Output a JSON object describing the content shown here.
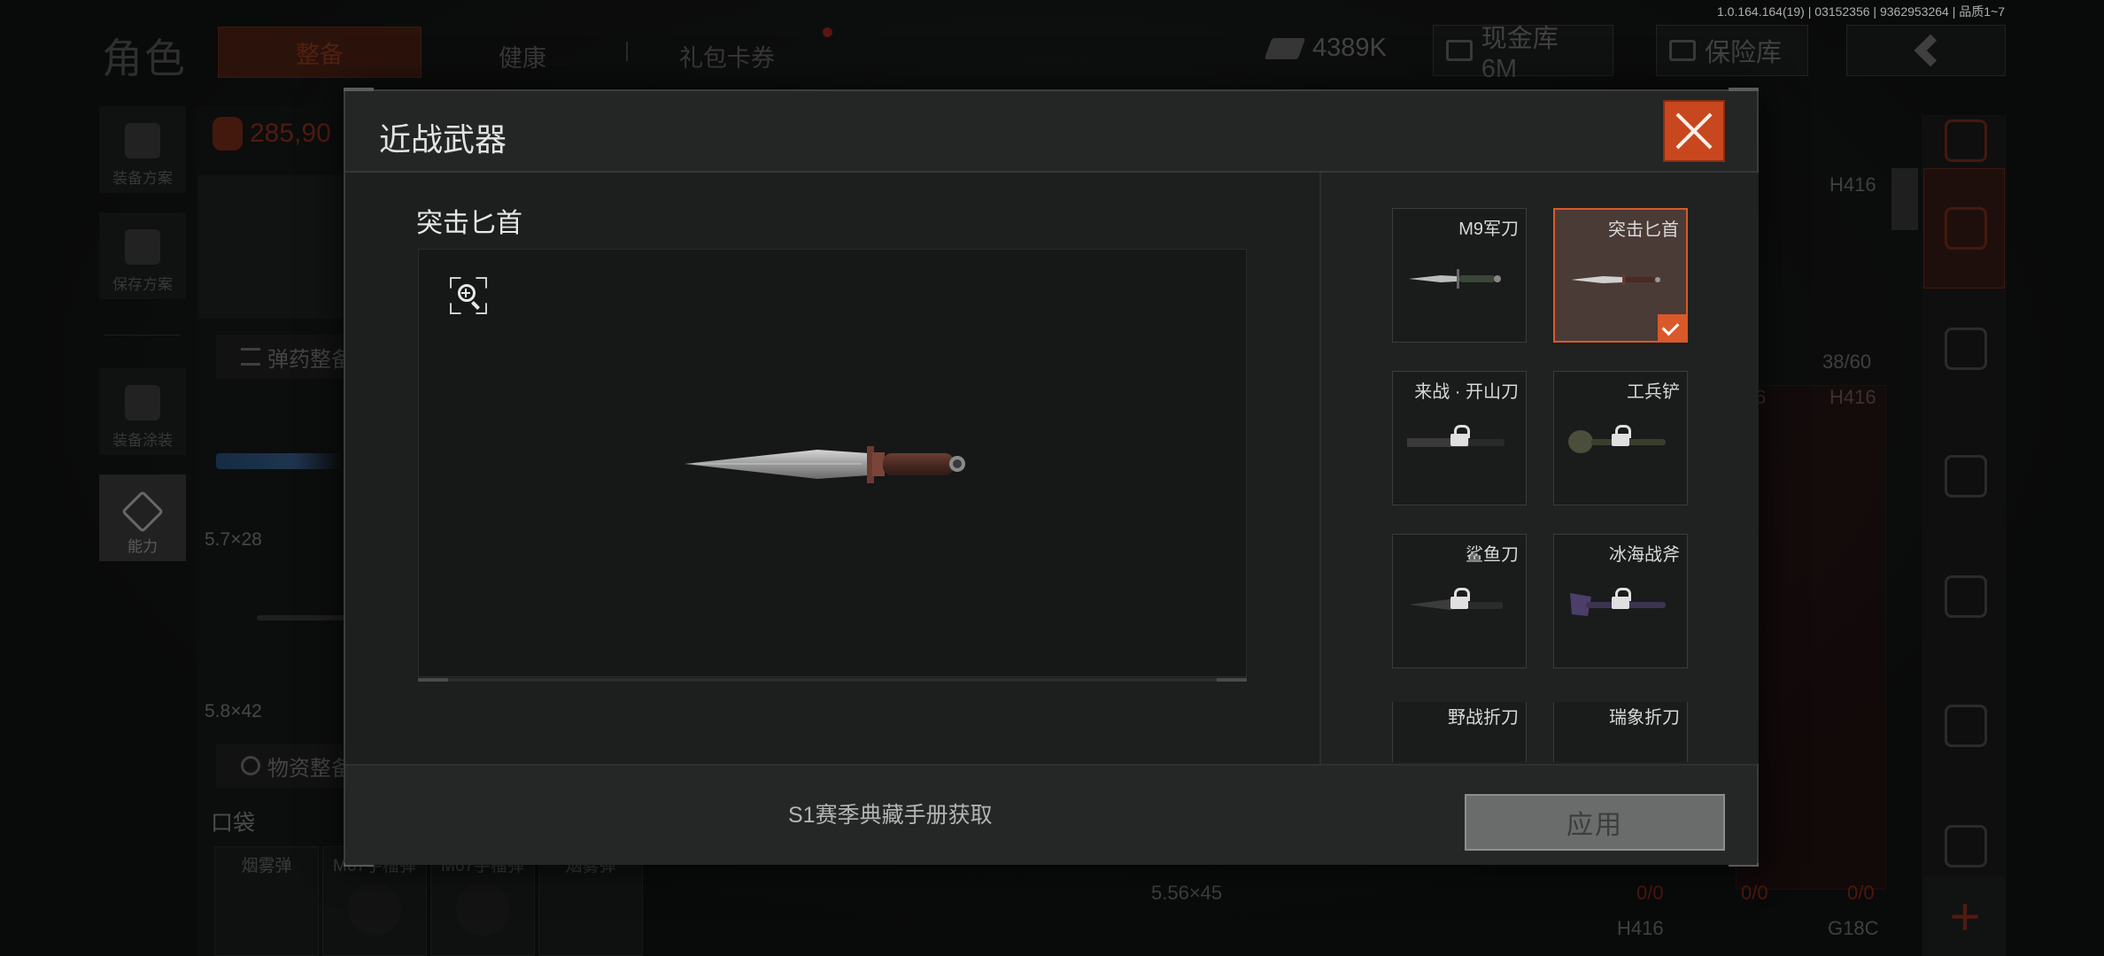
{
  "version_info": "1.0.164.164(19) | 03152356 | 9362953264 | 品质1~7",
  "header": {
    "role_title": "角色",
    "tabs": [
      {
        "label": "整备",
        "active": true
      },
      {
        "label": "健康",
        "active": false
      },
      {
        "label": "礼包卡券",
        "active": false
      }
    ],
    "currency_amount": "4389K",
    "cash_vault_label": "现金库 6M",
    "safe_label": "保险库"
  },
  "sidebar": {
    "items": [
      {
        "label": "装备方案"
      },
      {
        "label": "保存方案"
      },
      {
        "label": "装备涂装"
      },
      {
        "label": "能力"
      }
    ]
  },
  "left_panel": {
    "money": "285,90",
    "ammo_section": "弹药整备",
    "caliber_1": "5.7×28",
    "caliber_2": "5.8×42",
    "supply_section": "物资整备",
    "pocket_title": "口袋",
    "pocket_items": [
      "烟雾弹",
      "M67手榴弹",
      "M67手榴弹",
      "烟雾弹"
    ]
  },
  "right_panel": {
    "weapon_1": "H416",
    "ammo_count": "38/60",
    "weapon_2": "H416",
    "partial_num": "6",
    "bottom_caliber": "5.56×45",
    "counts": [
      "0/0",
      "0/0",
      "0/0"
    ],
    "bottom_weapons": [
      "H416",
      "G18C"
    ]
  },
  "modal": {
    "title": "近战武器",
    "preview_name": "突击匕首",
    "source_text": "S1赛季典藏手册获取",
    "apply_label": "应用",
    "weapons": [
      {
        "name": "M9军刀",
        "locked": false,
        "selected": false
      },
      {
        "name": "突击匕首",
        "locked": false,
        "selected": true
      },
      {
        "name": "来战 · 开山刀",
        "locked": true,
        "selected": false
      },
      {
        "name": "工兵铲",
        "locked": true,
        "selected": false
      },
      {
        "name": "鲨鱼刀",
        "locked": true,
        "selected": false
      },
      {
        "name": "冰海战斧",
        "locked": true,
        "selected": false
      },
      {
        "name": "野战折刀",
        "locked": true,
        "selected": false
      },
      {
        "name": "瑞象折刀",
        "locked": true,
        "selected": false
      }
    ]
  },
  "colors": {
    "accent_orange": "#d9592a",
    "close_button": "#c8471e",
    "apply_disabled": "#6a6b6b"
  }
}
